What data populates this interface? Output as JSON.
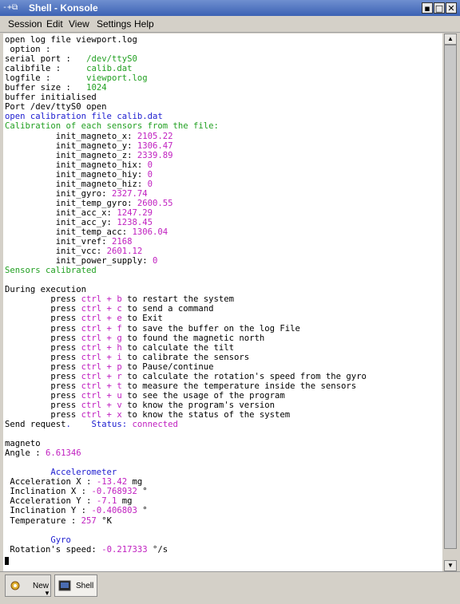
{
  "window": {
    "title": "Shell - Konsole",
    "sys_icon": "-+⧉"
  },
  "menu": [
    "Session",
    "Edit",
    "View",
    "Settings",
    "Help"
  ],
  "terminal_lines": [
    [
      {
        "t": "open log file viewport.log",
        "c": ""
      }
    ],
    [
      {
        "t": " option :",
        "c": ""
      }
    ],
    [
      {
        "t": "serial port :   ",
        "c": ""
      },
      {
        "t": "/dev/ttyS0",
        "c": "g"
      }
    ],
    [
      {
        "t": "calibfile :     ",
        "c": ""
      },
      {
        "t": "calib.dat",
        "c": "g"
      }
    ],
    [
      {
        "t": "logfile :       ",
        "c": ""
      },
      {
        "t": "viewport.log",
        "c": "g"
      }
    ],
    [
      {
        "t": "buffer size :   ",
        "c": ""
      },
      {
        "t": "1024",
        "c": "g"
      }
    ],
    [
      {
        "t": "buffer initialised",
        "c": ""
      }
    ],
    [
      {
        "t": "Port /dev/ttyS0 open",
        "c": ""
      }
    ],
    [
      {
        "t": "open calibration file calib.dat",
        "c": "b"
      }
    ],
    [
      {
        "t": "Calibration of each sensors from the file:",
        "c": "g"
      }
    ],
    [
      {
        "t": "          init_magneto_x: ",
        "c": ""
      },
      {
        "t": "2105.22",
        "c": "m"
      }
    ],
    [
      {
        "t": "          init_magneto_y: ",
        "c": ""
      },
      {
        "t": "1306.47",
        "c": "m"
      }
    ],
    [
      {
        "t": "          init_magneto_z: ",
        "c": ""
      },
      {
        "t": "2339.89",
        "c": "m"
      }
    ],
    [
      {
        "t": "          init_magneto_hix: ",
        "c": ""
      },
      {
        "t": "0",
        "c": "m"
      }
    ],
    [
      {
        "t": "          init_magneto_hiy: ",
        "c": ""
      },
      {
        "t": "0",
        "c": "m"
      }
    ],
    [
      {
        "t": "          init_magneto_hiz: ",
        "c": ""
      },
      {
        "t": "0",
        "c": "m"
      }
    ],
    [
      {
        "t": "          init_gyro: ",
        "c": ""
      },
      {
        "t": "2327.74",
        "c": "m"
      }
    ],
    [
      {
        "t": "          init_temp_gyro: ",
        "c": ""
      },
      {
        "t": "2600.55",
        "c": "m"
      }
    ],
    [
      {
        "t": "          init_acc_x: ",
        "c": ""
      },
      {
        "t": "1247.29",
        "c": "m"
      }
    ],
    [
      {
        "t": "          init_acc_y: ",
        "c": ""
      },
      {
        "t": "1238.45",
        "c": "m"
      }
    ],
    [
      {
        "t": "          init_temp_acc: ",
        "c": ""
      },
      {
        "t": "1306.04",
        "c": "m"
      }
    ],
    [
      {
        "t": "          init_vref: ",
        "c": ""
      },
      {
        "t": "2168",
        "c": "m"
      }
    ],
    [
      {
        "t": "          init_vcc: ",
        "c": ""
      },
      {
        "t": "2601.12",
        "c": "m"
      }
    ],
    [
      {
        "t": "          init_power_supply: ",
        "c": ""
      },
      {
        "t": "0",
        "c": "m"
      }
    ],
    [
      {
        "t": "Sensors calibrated",
        "c": "g"
      }
    ],
    [],
    [
      {
        "t": "During execution",
        "c": ""
      }
    ],
    [
      {
        "t": "         press ",
        "c": ""
      },
      {
        "t": "ctrl + b",
        "c": "m"
      },
      {
        "t": " to restart the system",
        "c": ""
      }
    ],
    [
      {
        "t": "         press ",
        "c": ""
      },
      {
        "t": "ctrl + c",
        "c": "m"
      },
      {
        "t": " to send a command",
        "c": ""
      }
    ],
    [
      {
        "t": "         press ",
        "c": ""
      },
      {
        "t": "ctrl + e",
        "c": "m"
      },
      {
        "t": " to Exit",
        "c": ""
      }
    ],
    [
      {
        "t": "         press ",
        "c": ""
      },
      {
        "t": "ctrl + f",
        "c": "m"
      },
      {
        "t": " to save the buffer on the log File",
        "c": ""
      }
    ],
    [
      {
        "t": "         press ",
        "c": ""
      },
      {
        "t": "ctrl + g",
        "c": "m"
      },
      {
        "t": " to found the magnetic north",
        "c": ""
      }
    ],
    [
      {
        "t": "         press ",
        "c": ""
      },
      {
        "t": "ctrl + h",
        "c": "m"
      },
      {
        "t": " to calculate the tilt",
        "c": ""
      }
    ],
    [
      {
        "t": "         press ",
        "c": ""
      },
      {
        "t": "ctrl + i",
        "c": "m"
      },
      {
        "t": " to calibrate the sensors",
        "c": ""
      }
    ],
    [
      {
        "t": "         press ",
        "c": ""
      },
      {
        "t": "ctrl + p",
        "c": "m"
      },
      {
        "t": " to Pause/continue",
        "c": ""
      }
    ],
    [
      {
        "t": "         press ",
        "c": ""
      },
      {
        "t": "ctrl + r",
        "c": "m"
      },
      {
        "t": " to calculate the rotation's speed from the gyro",
        "c": ""
      }
    ],
    [
      {
        "t": "         press ",
        "c": ""
      },
      {
        "t": "ctrl + t",
        "c": "m"
      },
      {
        "t": " to measure the temperature inside the sensors",
        "c": ""
      }
    ],
    [
      {
        "t": "         press ",
        "c": ""
      },
      {
        "t": "ctrl + u",
        "c": "m"
      },
      {
        "t": " to see the usage of the program",
        "c": ""
      }
    ],
    [
      {
        "t": "         press ",
        "c": ""
      },
      {
        "t": "ctrl + v",
        "c": "m"
      },
      {
        "t": " to know the program's version",
        "c": ""
      }
    ],
    [
      {
        "t": "         press ",
        "c": ""
      },
      {
        "t": "ctrl + x",
        "c": "m"
      },
      {
        "t": " to know the status of the system",
        "c": ""
      }
    ],
    [
      {
        "t": "Send request",
        "c": ""
      },
      {
        "t": ".",
        "c": "b"
      },
      {
        "t": "    ",
        "c": ""
      },
      {
        "t": "Status:",
        "c": "b"
      },
      {
        "t": " ",
        "c": ""
      },
      {
        "t": "connected",
        "c": "m"
      }
    ],
    [],
    [
      {
        "t": "magneto",
        "c": ""
      }
    ],
    [
      {
        "t": "Angle : ",
        "c": ""
      },
      {
        "t": "6.61346",
        "c": "m"
      }
    ],
    [],
    [
      {
        "t": "         Accelerometer",
        "c": "b"
      }
    ],
    [
      {
        "t": " Acceleration X : ",
        "c": ""
      },
      {
        "t": "-13.42",
        "c": "m"
      },
      {
        "t": " mg",
        "c": ""
      }
    ],
    [
      {
        "t": " Inclination X : ",
        "c": ""
      },
      {
        "t": "-0.768932",
        "c": "m"
      },
      {
        "t": " °",
        "c": ""
      }
    ],
    [
      {
        "t": " Acceleration Y : ",
        "c": ""
      },
      {
        "t": "-7.1",
        "c": "m"
      },
      {
        "t": " mg",
        "c": ""
      }
    ],
    [
      {
        "t": " Inclination Y : ",
        "c": ""
      },
      {
        "t": "-0.406803",
        "c": "m"
      },
      {
        "t": " °",
        "c": ""
      }
    ],
    [
      {
        "t": " Temperature : ",
        "c": ""
      },
      {
        "t": "257",
        "c": "m"
      },
      {
        "t": " °K",
        "c": ""
      }
    ],
    [],
    [
      {
        "t": "         Gyro",
        "c": "b"
      }
    ],
    [
      {
        "t": " Rotation's speed: ",
        "c": ""
      },
      {
        "t": "-0.217333",
        "c": "m"
      },
      {
        "t": " °/s",
        "c": ""
      }
    ]
  ],
  "tabs": {
    "new_label": "New",
    "shell_label": "Shell"
  },
  "colors": {
    "green": "#22a022",
    "magenta": "#c020c0",
    "blue": "#2020d0",
    "titlebar": "#3c62b4"
  }
}
